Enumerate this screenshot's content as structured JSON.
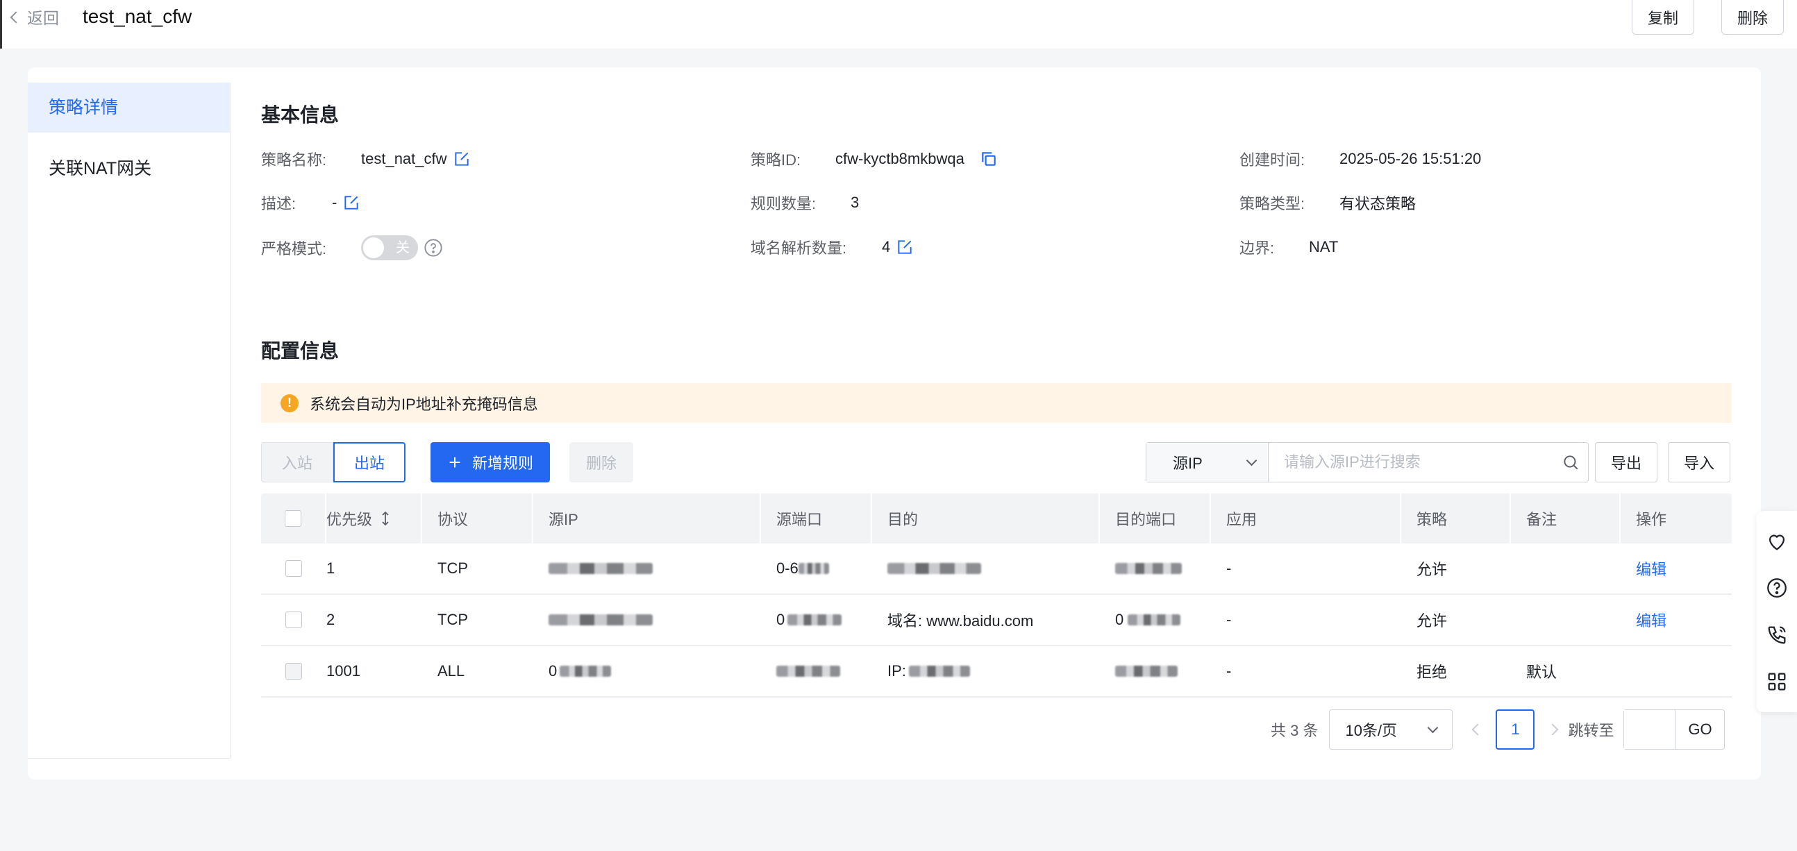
{
  "header": {
    "back_label": "返回",
    "title": "test_nat_cfw",
    "copy_label": "复制",
    "delete_label": "删除"
  },
  "nav": {
    "items": [
      {
        "label": "策略详情",
        "active": true
      },
      {
        "label": "关联NAT网关",
        "active": false
      }
    ]
  },
  "basic": {
    "title": "基本信息",
    "name_label": "策略名称:",
    "name_value": "test_nat_cfw",
    "id_label": "策略ID:",
    "id_value": "cfw-kyctb8mkbwqa",
    "created_label": "创建时间:",
    "created_value": "2025-05-26 15:51:20",
    "desc_label": "描述:",
    "desc_value": "-",
    "rules_label": "规则数量:",
    "rules_value": "3",
    "type_label": "策略类型:",
    "type_value": "有状态策略",
    "strict_label": "严格模式:",
    "strict_toggle": "关",
    "strict_on": false,
    "domain_label": "域名解析数量:",
    "domain_value": "4",
    "border_label": "边界:",
    "border_value": "NAT"
  },
  "config": {
    "title": "配置信息",
    "alert": "系统会自动为IP地址补充掩码信息",
    "tab_in": "入站",
    "tab_out": "出站",
    "add_rule": "新增规则",
    "delete": "删除",
    "search_field": "源IP",
    "search_placeholder": "请输入源IP进行搜索",
    "export": "导出",
    "import": "导入"
  },
  "table": {
    "columns": [
      "优先级",
      "协议",
      "源IP",
      "源端口",
      "目的",
      "目的端口",
      "应用",
      "策略",
      "备注",
      "操作"
    ],
    "rows": [
      {
        "priority": "1",
        "protocol": "TCP",
        "src_port_prefix": "0-6",
        "dest": "",
        "app": "-",
        "policy": "允许",
        "note": "",
        "action": "编辑"
      },
      {
        "priority": "2",
        "protocol": "TCP",
        "src_port_prefix": "0",
        "dest": "域名: www.baidu.com",
        "dest_port_prefix": "0",
        "app": "-",
        "policy": "允许",
        "note": "",
        "action": "编辑"
      },
      {
        "priority": "1001",
        "protocol": "ALL",
        "src_ip_prefix": "0",
        "dest": "IP: ",
        "app": "-",
        "policy": "拒绝",
        "note": "默认",
        "action": ""
      }
    ]
  },
  "pagination": {
    "total": "共 3 条",
    "page_size": "10条/页",
    "current_page": "1",
    "jump_label": "跳转至",
    "go": "GO"
  },
  "colors": {
    "primary": "#2468f2",
    "alert_bg": "#fff4e5",
    "warning": "#f5a623"
  }
}
